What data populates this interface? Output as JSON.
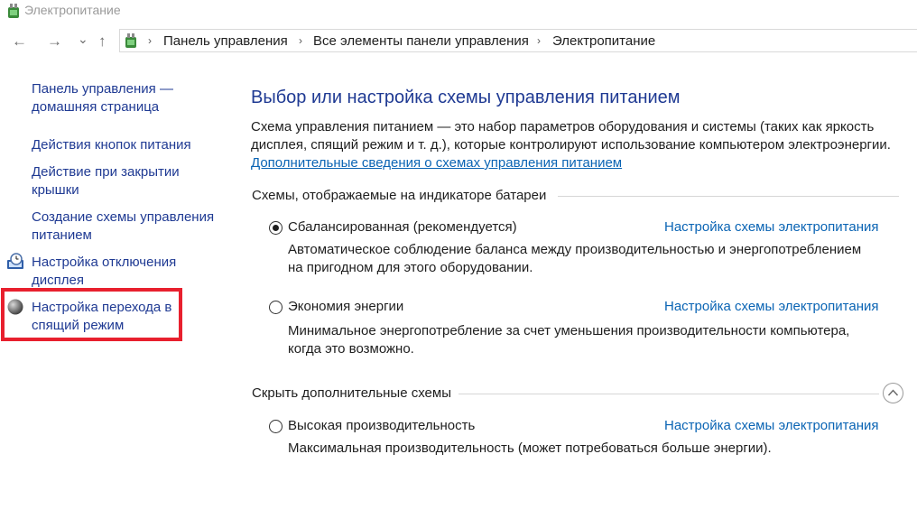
{
  "window": {
    "title": "Электропитание"
  },
  "nav": {
    "back_glyph": "←",
    "forward_glyph": "→",
    "recent_glyph": "⌄",
    "up_glyph": "↑"
  },
  "breadcrumb": {
    "items": [
      "Панель управления",
      "Все элементы панели управления",
      "Электропитание"
    ],
    "separator": "›"
  },
  "sidebar": {
    "items": [
      {
        "label_lines": [
          "Панель управления —",
          "домашняя страница"
        ]
      },
      {
        "label_lines": [
          "Действия кнопок питания"
        ]
      },
      {
        "label_lines": [
          "Действие при закрытии",
          "крышки"
        ]
      },
      {
        "label_lines": [
          "Создание схемы управления",
          "питанием"
        ]
      },
      {
        "label_lines": [
          "Настройка отключения",
          "дисплея"
        ],
        "icon": "monitor-clock-icon"
      },
      {
        "label_lines": [
          "Настройка перехода в",
          "спящий режим"
        ],
        "icon": "moon-icon"
      }
    ],
    "highlight_color": "#e8202e"
  },
  "main": {
    "heading": "Выбор или настройка схемы управления питанием",
    "description_lines": [
      "Схема управления питанием — это набор параметров оборудования и системы (таких как яркость",
      "дисплея, спящий режим и т. д.), которые контролируют использование компьютером электроэнергии."
    ],
    "more_info_link": "Дополнительные сведения о схемах управления питанием",
    "battery_section_title": "Схемы, отображаемые на индикаторе батареи",
    "hidden_section_title": "Скрыть дополнительные схемы",
    "plans": [
      {
        "name": "Сбалансированная (рекомендуется)",
        "selected": true,
        "link": "Настройка схемы электропитания",
        "desc_lines": [
          "Автоматическое соблюдение баланса между производительностью и энергопотреблением",
          "на пригодном для этого оборудовании."
        ]
      },
      {
        "name": "Экономия энергии",
        "selected": false,
        "link": "Настройка схемы электропитания",
        "desc_lines": [
          "Минимальное энергопотребление за счет уменьшения производительности компьютера,",
          "когда это возможно."
        ]
      },
      {
        "name": "Высокая производительность",
        "selected": false,
        "link": "Настройка схемы электропитания",
        "desc_lines": [
          "Максимальная производительность (может потребоваться больше энергии)."
        ]
      }
    ]
  },
  "colors": {
    "heading": "#1f3a93",
    "link": "#0a64b4",
    "text": "#1e1e1e"
  }
}
